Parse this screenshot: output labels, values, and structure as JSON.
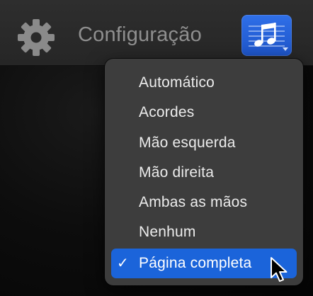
{
  "toolbar": {
    "settings_icon": "gear-icon",
    "title": "Configuração",
    "view_button_icon": "music-notes-icon"
  },
  "menu": {
    "items": [
      {
        "label": "Automático",
        "selected": false
      },
      {
        "label": "Acordes",
        "selected": false
      },
      {
        "label": "Mão esquerda",
        "selected": false
      },
      {
        "label": "Mão direita",
        "selected": false
      },
      {
        "label": "Ambas as mãos",
        "selected": false
      },
      {
        "label": "Nenhum",
        "selected": false
      },
      {
        "label": "Página completa",
        "selected": true
      }
    ],
    "check_mark": "✓"
  },
  "colors": {
    "accent": "#1b64da",
    "button": "#2b67e0",
    "menu_bg": "#3d3d3d",
    "title": "#8f8f8f"
  }
}
